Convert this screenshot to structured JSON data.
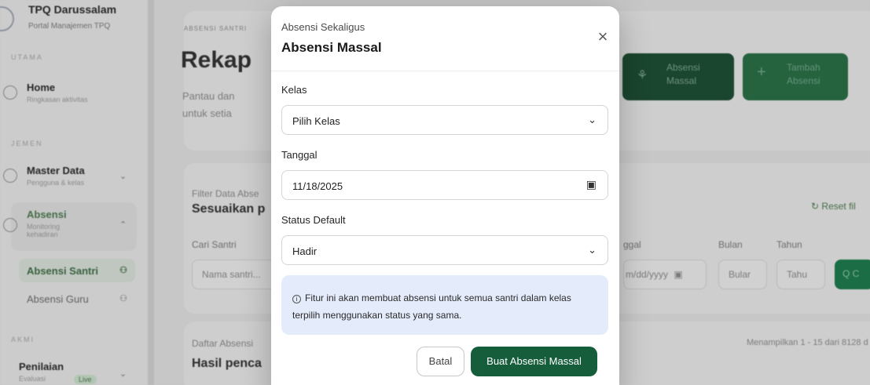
{
  "sidebar": {
    "brand_title": "TPQ Darussalam",
    "brand_subtitle": "Portal Manajemen TPQ",
    "section_main": "UTAMA",
    "section_manage": "JEMEN",
    "section_other": "AKMI",
    "home_title": "Home",
    "home_sub": "Ringkasan aktivitas",
    "master_title": "Master Data",
    "master_sub": "Pengguna & kelas",
    "absensi_title": "Absensi",
    "absensi_sub": "Monitoring kehadiran",
    "absensi_santri": "Absensi Santri",
    "absensi_guru": "Absensi Guru",
    "penilaian_title": "Penilaian",
    "penilaian_sub": "Evaluasi",
    "penilaian_badge": "Live"
  },
  "hero": {
    "eyebrow": "ABSENSI SANTRI",
    "title": "Rekap",
    "desc_line1": "Pantau dan",
    "desc_line2": "untuk setia",
    "btn_massal_line1": "Absensi",
    "btn_massal_line2": "Massal",
    "btn_tambah_line1": "Tambah",
    "btn_tambah_line2": "Absensi"
  },
  "filter": {
    "eyebrow": "Filter Data Abse",
    "title": "Sesuaikan p",
    "reset": "Reset fil",
    "cari_label": "Cari Santri",
    "cari_placeholder": "Nama santri...",
    "tanggal_label": "ggal",
    "tanggal_value": "m/dd/yyyy",
    "bulan_label": "Bulan",
    "bulan_value": "Bular",
    "tahun_label": "Tahun",
    "tahun_value": "Tahu",
    "search_label": "Q C"
  },
  "list": {
    "eyebrow": "Daftar Absensi",
    "title": "Hasil penca",
    "count": "Menampilkan 1 - 15 dari 8128 d"
  },
  "modal": {
    "eyebrow": "Absensi Sekaligus",
    "title": "Absensi Massal",
    "kelas_label": "Kelas",
    "kelas_value": "Pilih Kelas",
    "tanggal_label": "Tanggal",
    "tanggal_value": "11/18/2025",
    "status_label": "Status Default",
    "status_value": "Hadir",
    "info_text": "Fitur ini akan membuat absensi untuk semua santri dalam kelas terpilih menggunakan status yang sama.",
    "cancel_label": "Batal",
    "submit_label": "Buat Absensi Massal"
  }
}
